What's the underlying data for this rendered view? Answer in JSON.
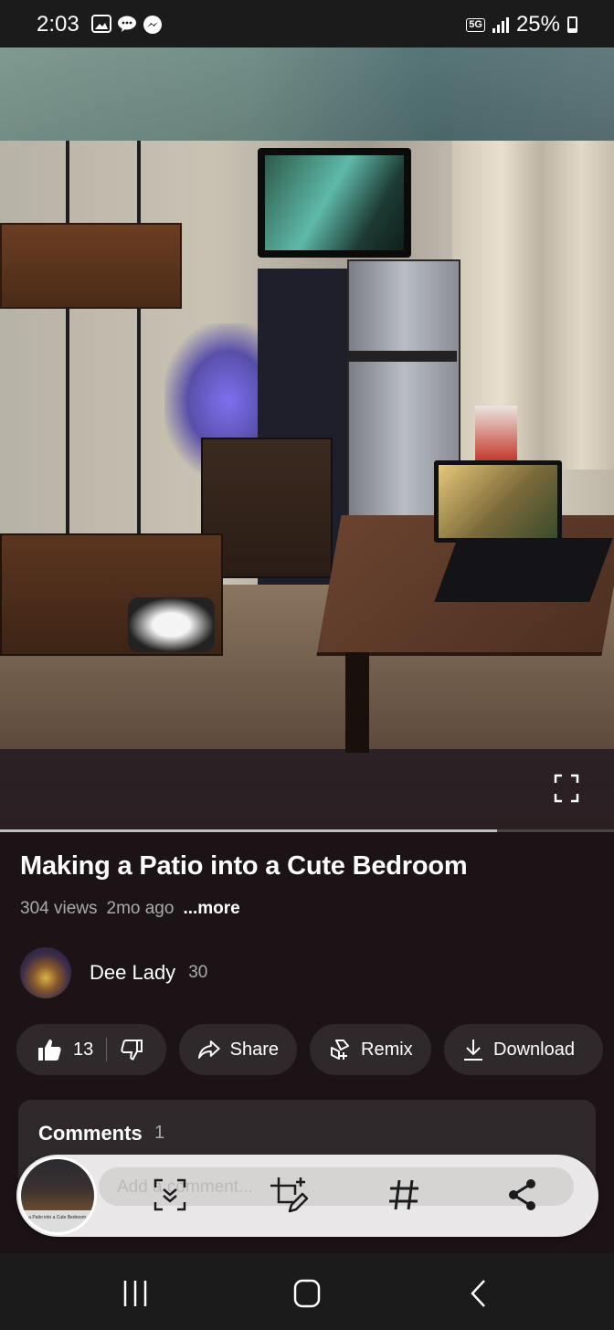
{
  "status_bar": {
    "time": "2:03",
    "network": "5G",
    "battery": "25%"
  },
  "video": {
    "progress": 0.81
  },
  "info": {
    "title": "Making a Patio into a Cute Bedroom",
    "views": "304 views",
    "age": "2mo ago",
    "more": "...more"
  },
  "channel": {
    "name": "Dee Lady",
    "count": "30"
  },
  "actions": {
    "like_count": "13",
    "share": "Share",
    "remix": "Remix",
    "download": "Download"
  },
  "comments": {
    "title": "Comments",
    "count": "1"
  },
  "dock": {
    "placeholder": "Add a comment...",
    "thumb_caption": "g a Patio into a Cute Bedroom",
    "icons": [
      "scan-icon",
      "crop-edit-icon",
      "hashtag-icon",
      "share-icon"
    ]
  },
  "colors": {
    "background": "#161012",
    "pill": "#30292b",
    "dock": "#e9e7e7"
  }
}
